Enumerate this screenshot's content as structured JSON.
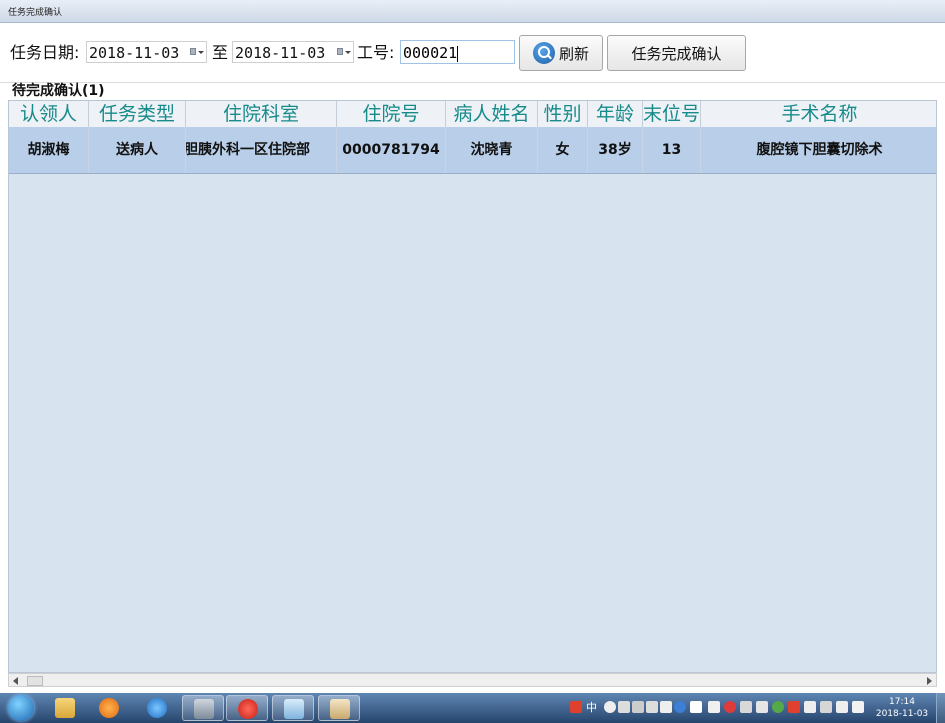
{
  "window": {
    "title": "任务完成确认"
  },
  "toolbar": {
    "date_label": "任务日期:",
    "date_from": "2018-11-03",
    "to_label": "至",
    "date_to": "2018-11-03",
    "emp_label": "工号:",
    "emp_value": "000021",
    "refresh_label": "刷新",
    "confirm_label": "任务完成确认"
  },
  "pending": {
    "label": "待完成确认(1)"
  },
  "table": {
    "columns": [
      "认领人",
      "任务类型",
      "住院科室",
      "住院号",
      "病人姓名",
      "性别",
      "年龄",
      "末位号",
      "手术名称"
    ],
    "rows": [
      [
        "胡淑梅",
        "送病人",
        "肝胆胰外科一区住院部",
        "0000781794",
        "沈晓青",
        "女",
        "38岁",
        "13",
        "腹腔镜下胆囊切除术"
      ]
    ]
  },
  "taskbar": {
    "clock_time": "17:14",
    "clock_date": "2018-11-03",
    "ime_label": "中"
  }
}
